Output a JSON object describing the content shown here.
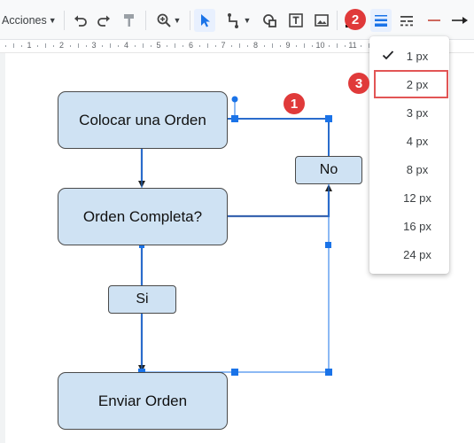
{
  "toolbar": {
    "actions_label": "Acciones",
    "icons": [
      "undo-icon",
      "redo-icon",
      "paint-format-icon",
      "zoom-icon",
      "select-arrow-icon",
      "connector-line-icon",
      "shape-icon",
      "text-box-icon",
      "image-icon",
      "line-color-icon",
      "line-weight-icon",
      "line-dash-icon",
      "line-start-icon",
      "line-end-icon"
    ]
  },
  "ruler": {
    "numbers": [
      "1",
      "2",
      "3",
      "4",
      "5",
      "6",
      "7",
      "8",
      "9",
      "10",
      "11"
    ]
  },
  "flowchart": {
    "place_order": "Colocar una Orden",
    "order_complete": "Orden Completa?",
    "yes_label": "Si",
    "no_label": "No",
    "send_order": "Enviar Orden"
  },
  "line_weight_menu": {
    "items": [
      "1 px",
      "2 px",
      "3 px",
      "4 px",
      "8 px",
      "12 px",
      "16 px",
      "24 px"
    ],
    "checked": "1 px",
    "highlighted": "2 px"
  },
  "callouts": {
    "one": "1",
    "two": "2",
    "three": "3"
  },
  "colors": {
    "shape_fill": "#cfe2f3",
    "selection": "#1a73e8",
    "callout": "#e03a3a",
    "active_tool": "#e8f0fe"
  }
}
